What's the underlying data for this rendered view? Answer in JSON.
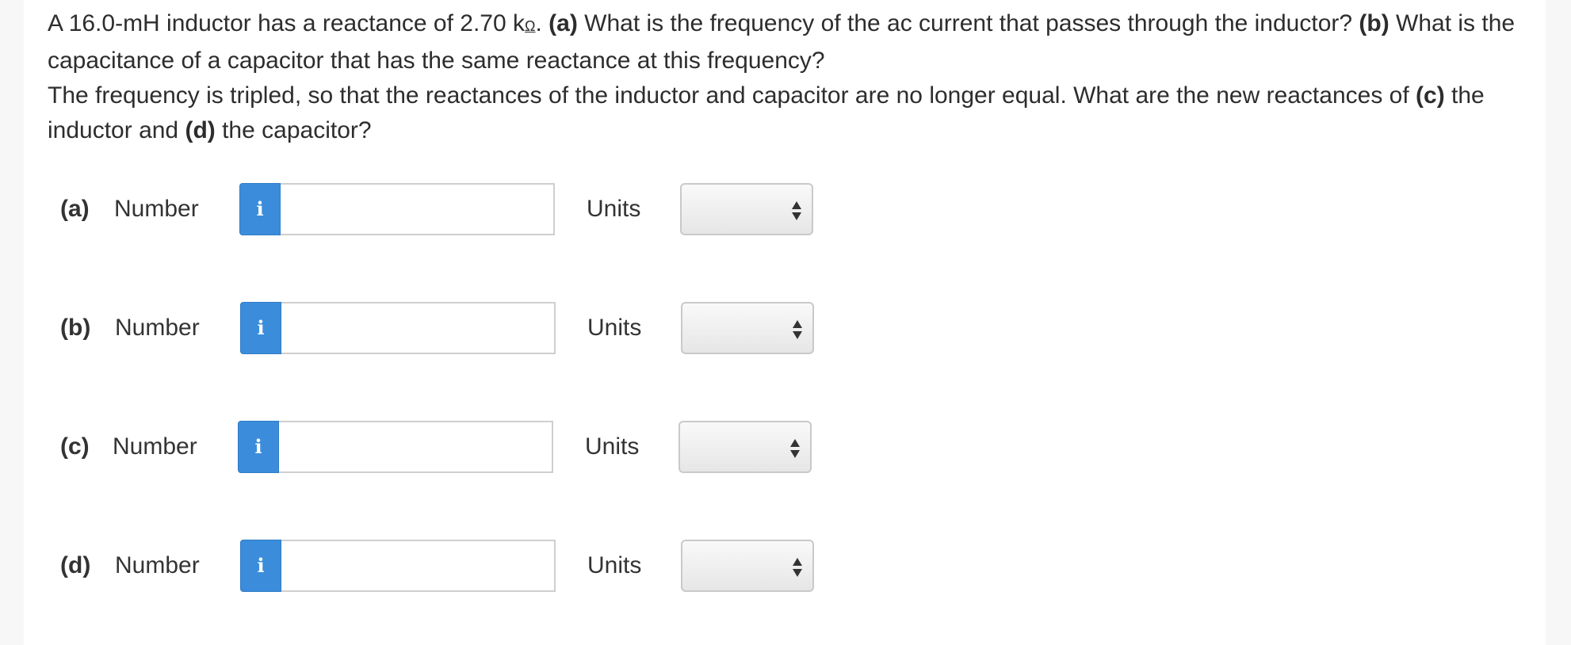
{
  "question": {
    "p1_a": "A 16.0-mH inductor has a reactance of 2.70 k",
    "p1_unit": "Ω",
    "p1_b": ". ",
    "tag_a": "(a)",
    "p1_c": " What is the frequency of the ac current that passes through the inductor? ",
    "tag_b": "(b)",
    "p1_d": " What is the capacitance of a capacitor that has the same reactance at this frequency?",
    "p2_a": "The frequency is tripled, so that the reactances of the inductor and capacitor are no longer equal. What are the new reactances of ",
    "tag_c": "(c)",
    "p2_b": " the inductor and ",
    "tag_d": "(d)",
    "p2_c": " the capacitor?"
  },
  "answers": [
    {
      "part": "(a)",
      "number_label": "Number",
      "info_icon": "i",
      "value": "",
      "units_label": "Units",
      "units_selected": ""
    },
    {
      "part": "(b)",
      "number_label": "Number",
      "info_icon": "i",
      "value": "",
      "units_label": "Units",
      "units_selected": ""
    },
    {
      "part": "(c)",
      "number_label": "Number",
      "info_icon": "i",
      "value": "",
      "units_label": "Units",
      "units_selected": ""
    },
    {
      "part": "(d)",
      "number_label": "Number",
      "info_icon": "i",
      "value": "",
      "units_label": "Units",
      "units_selected": ""
    }
  ],
  "colors": {
    "info_button": "#3b8ddb",
    "input_border": "#cfcfcf",
    "text": "#2d2d2d"
  }
}
